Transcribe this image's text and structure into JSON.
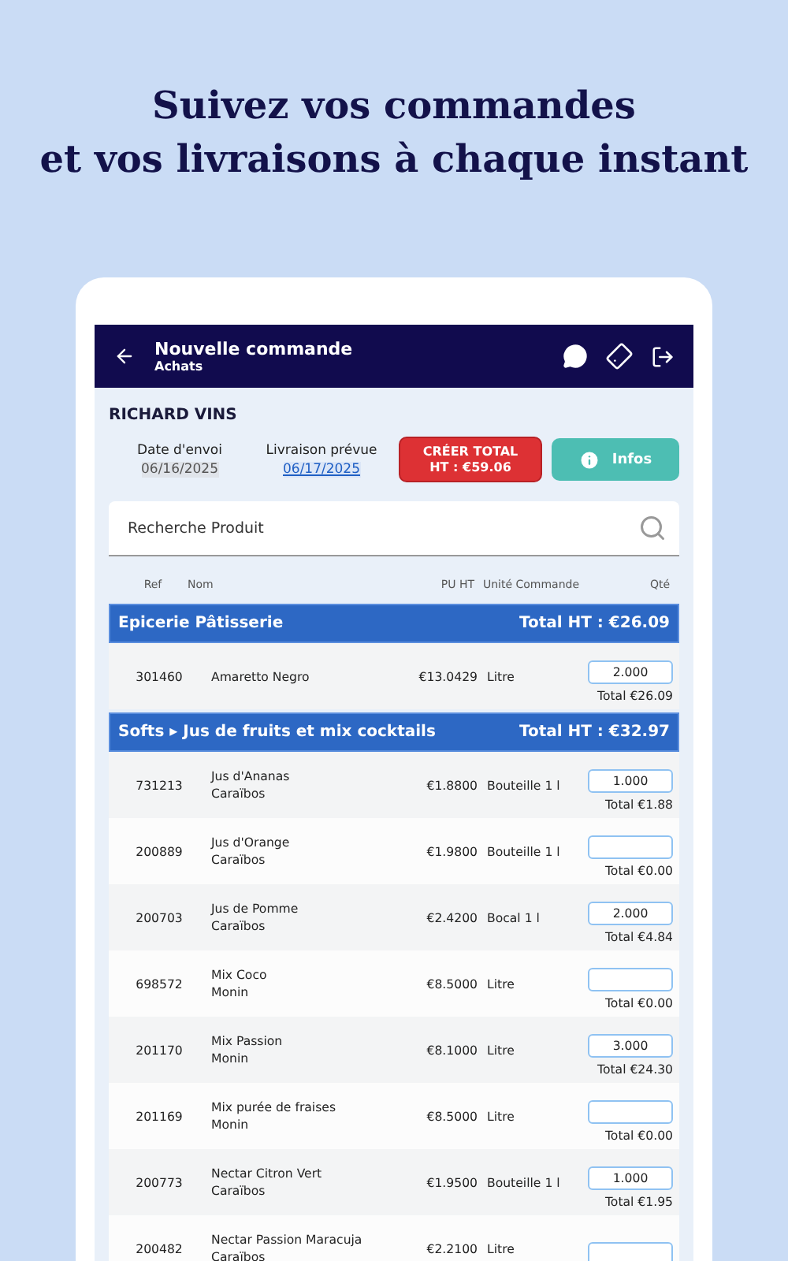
{
  "headline": [
    "Suivez vos commandes",
    "et vos livraisons à chaque instant"
  ],
  "app_bar": {
    "title": "Nouvelle commande",
    "subtitle": "Achats"
  },
  "supplier": "RICHARD VINS",
  "dates": [
    {
      "label": "Date d'envoi",
      "value": "06/16/2025",
      "kind": "sent"
    },
    {
      "label": "Livraison prévue",
      "value": "06/17/2025",
      "kind": "link"
    }
  ],
  "create_button": [
    "CRÉER TOTAL",
    "HT : €59.06"
  ],
  "info_button": "Infos",
  "search": {
    "placeholder": "Recherche Produit"
  },
  "columns": [
    "Ref",
    "Nom",
    "PU HT",
    "Unité Commande",
    "Qté"
  ],
  "groups": [
    {
      "name": "Epicerie Pâtisserie",
      "total": "Total HT : €26.09",
      "rows": [
        {
          "ref": "301460",
          "name": [
            "Amaretto Negro"
          ],
          "price": "€13.0429",
          "unit": "Litre",
          "qty": "2.000",
          "total": "Total €26.09"
        }
      ]
    },
    {
      "name": "Softs ▸ Jus de fruits et mix cocktails",
      "total": "Total HT : €32.97",
      "rows": [
        {
          "ref": "731213",
          "name": [
            "Jus d'Ananas",
            "Caraïbos"
          ],
          "price": "€1.8800",
          "unit": "Bouteille 1 l",
          "qty": "1.000",
          "total": "Total €1.88"
        },
        {
          "ref": "200889",
          "name": [
            "Jus d'Orange",
            "Caraïbos"
          ],
          "price": "€1.9800",
          "unit": "Bouteille 1 l",
          "total": "Total €0.00"
        },
        {
          "ref": "200703",
          "name": [
            "Jus de Pomme",
            "Caraïbos"
          ],
          "price": "€2.4200",
          "unit": "Bocal 1 l",
          "qty": "2.000",
          "total": "Total €4.84"
        },
        {
          "ref": "698572",
          "name": [
            "Mix Coco",
            "Monin"
          ],
          "price": "€8.5000",
          "unit": "Litre",
          "total": "Total €0.00"
        },
        {
          "ref": "201170",
          "name": [
            "Mix Passion",
            "Monin"
          ],
          "price": "€8.1000",
          "unit": "Litre",
          "qty": "3.000",
          "total": "Total €24.30"
        },
        {
          "ref": "201169",
          "name": [
            "Mix purée de fraises",
            "Monin"
          ],
          "price": "€8.5000",
          "unit": "Litre",
          "total": "Total €0.00"
        },
        {
          "ref": "200773",
          "name": [
            "Nectar Citron Vert",
            "Caraïbos"
          ],
          "price": "€1.9500",
          "unit": "Bouteille 1 l",
          "qty": "1.000",
          "total": "Total €1.95"
        },
        {
          "ref": "200482",
          "name": [
            "Nectar Passion Maracuja",
            "Caraïbos"
          ],
          "price": "€2.2100",
          "unit": "Litre"
        }
      ]
    }
  ]
}
